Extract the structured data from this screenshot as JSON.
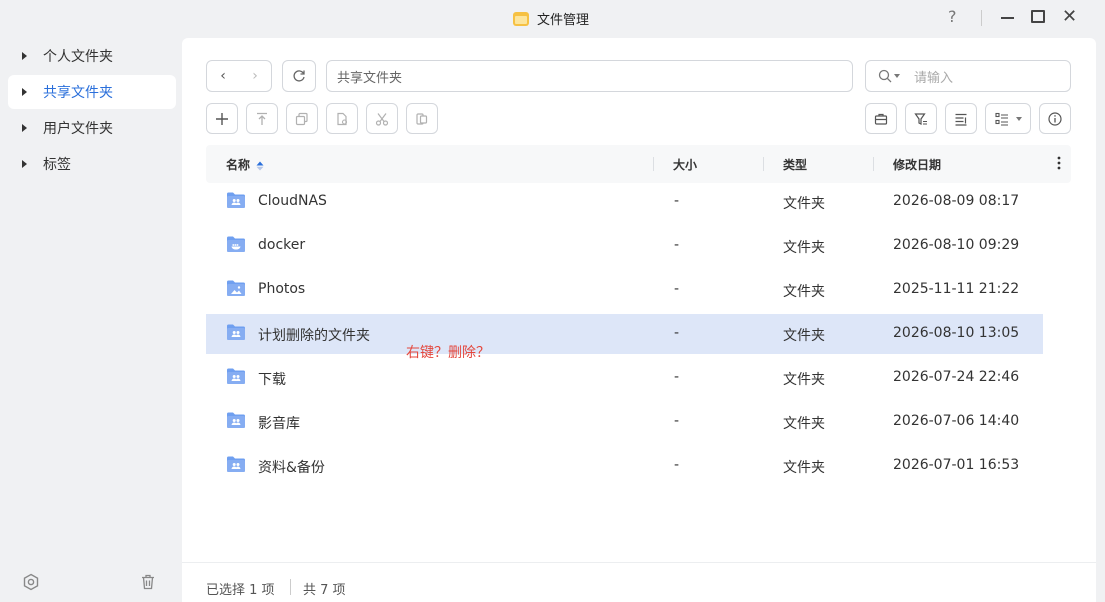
{
  "window": {
    "title": "文件管理",
    "help": "?",
    "close": "✕"
  },
  "sidebar": {
    "items": [
      {
        "label": "个人文件夹",
        "active": false
      },
      {
        "label": "共享文件夹",
        "active": true
      },
      {
        "label": "用户文件夹",
        "active": false
      },
      {
        "label": "标签",
        "active": false
      }
    ]
  },
  "toolbar": {
    "back": "‹",
    "forward": "›",
    "path_value": "共享文件夹",
    "search_placeholder": "请输入"
  },
  "table": {
    "columns": [
      "名称",
      "大小",
      "类型",
      "修改日期"
    ],
    "rows": [
      {
        "name": "CloudNAS",
        "size": "-",
        "type": "文件夹",
        "modified": "2026-08-09 08:17",
        "icon": "shared-folder-icon"
      },
      {
        "name": "docker",
        "size": "-",
        "type": "文件夹",
        "modified": "2026-08-10 09:29",
        "icon": "docker-folder-icon"
      },
      {
        "name": "Photos",
        "size": "-",
        "type": "文件夹",
        "modified": "2025-11-11 21:22",
        "icon": "photo-folder-icon"
      },
      {
        "name": "计划删除的文件夹",
        "size": "-",
        "type": "文件夹",
        "modified": "2026-08-10 13:05",
        "icon": "shared-folder-icon",
        "selected": true
      },
      {
        "name": "下载",
        "size": "-",
        "type": "文件夹",
        "modified": "2026-07-24 22:46",
        "icon": "shared-folder-icon"
      },
      {
        "name": "影音库",
        "size": "-",
        "type": "文件夹",
        "modified": "2026-07-06 14:40",
        "icon": "shared-folder-icon"
      },
      {
        "name": "资料&备份",
        "size": "-",
        "type": "文件夹",
        "modified": "2026-07-01 16:53",
        "icon": "shared-folder-icon"
      }
    ]
  },
  "annotation": "右键？删除？",
  "status": {
    "selected": "已选择 1 项",
    "total": "共 7 项"
  },
  "colors": {
    "accent": "#2a6fdb",
    "folder": "#6f9ff0",
    "selected_row": "#dde6f8",
    "annotation": "#e4473d"
  }
}
